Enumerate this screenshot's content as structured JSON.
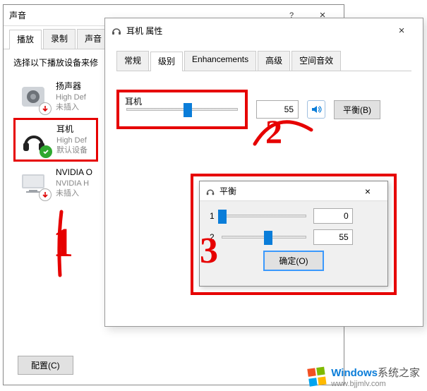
{
  "sound_window": {
    "title": "声音",
    "question_label": "?",
    "close_label": "×",
    "tabs": [
      "播放",
      "录制",
      "声音"
    ],
    "active_tab_index": 0,
    "instruction": "选择以下播放设备来修",
    "devices": [
      {
        "name": "扬声器",
        "desc": "High Def",
        "status": "未插入",
        "icon": "speaker",
        "badge": "down"
      },
      {
        "name": "耳机",
        "desc": "High Def",
        "status": "默认设备",
        "icon": "headphone",
        "badge": "ok",
        "selected": true
      },
      {
        "name": "NVIDIA O",
        "desc": "NVIDIA H",
        "status": "未插入",
        "icon": "monitor",
        "badge": "down"
      }
    ],
    "configure_button": "配置(C)"
  },
  "props_window": {
    "title": "耳机 属性",
    "close_label": "×",
    "tabs": [
      "常规",
      "级别",
      "Enhancements",
      "高级",
      "空间音效"
    ],
    "active_tab_index": 1,
    "level": {
      "label": "耳机",
      "value": "55",
      "slider_percent": 55
    },
    "balance_button": "平衡(B)"
  },
  "balance_popup": {
    "title": "平衡",
    "close_label": "×",
    "channels": [
      {
        "label": "1",
        "value": "0",
        "slider_percent": 0
      },
      {
        "label": "2",
        "value": "55",
        "slider_percent": 55
      }
    ],
    "ok_button": "确定(O)"
  },
  "annotations": {
    "step1": "1",
    "step2": "2",
    "step3": "3"
  },
  "watermark": {
    "brand": "Windows",
    "site": "系统之家",
    "url": "www.bjjmlv.com",
    "logo_colors": [
      "#f25022",
      "#7fba00",
      "#00a4ef",
      "#ffb900"
    ]
  }
}
